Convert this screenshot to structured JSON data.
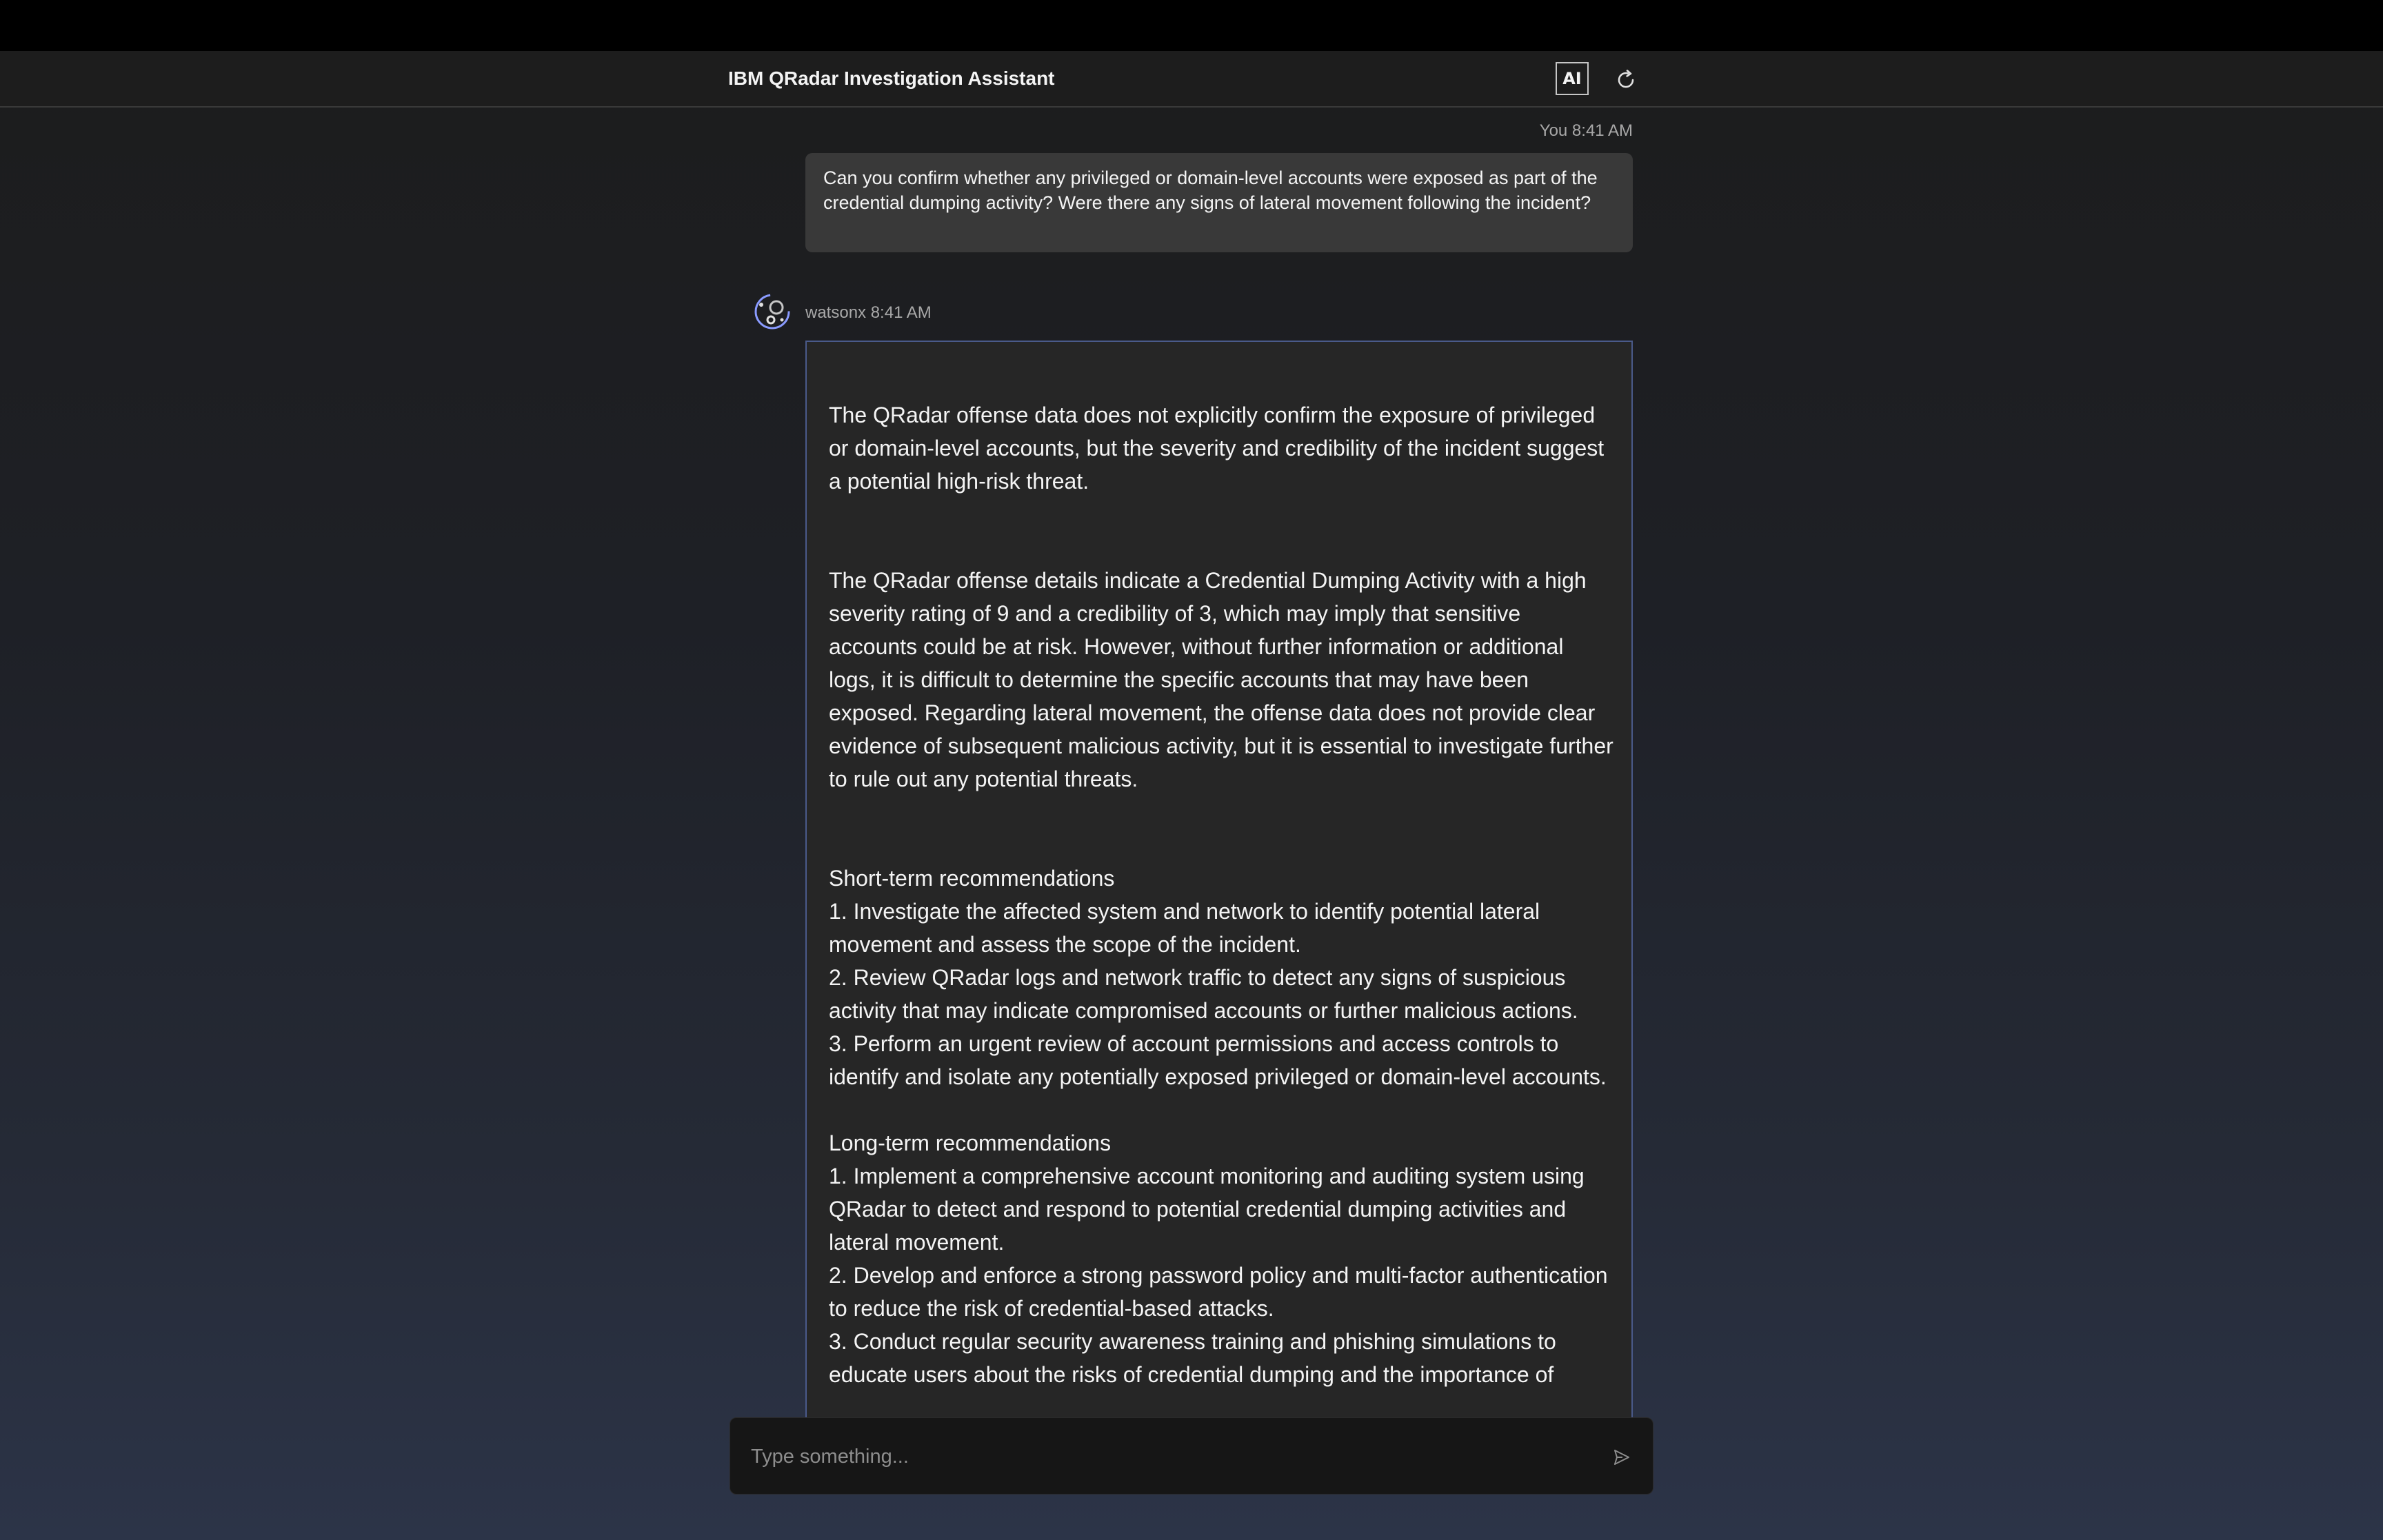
{
  "header": {
    "title": "IBM QRadar Investigation Assistant",
    "ai_badge": "AI",
    "refresh_icon": "refresh-icon"
  },
  "conversation": {
    "user_message": {
      "meta": "You 8:41 AM",
      "text": "Can you confirm whether any privileged or domain-level accounts were exposed as part of the credential dumping activity? Were there any signs of lateral movement following the incident?"
    },
    "assistant_message": {
      "avatar_icon": "watsonx-icon",
      "meta": "watsonx 8:41 AM",
      "text": "The QRadar offense data does not explicitly confirm the exposure of privileged or domain-level accounts, but the severity and credibility of the incident suggest a potential high-risk threat.\n\n\nThe QRadar offense details indicate a Credential Dumping Activity with a high severity rating of 9 and a credibility of 3, which may imply that sensitive accounts could be at risk. However, without further information or additional logs, it is difficult to determine the specific accounts that may have been exposed. Regarding lateral movement, the offense data does not provide clear evidence of subsequent malicious activity, but it is essential to investigate further to rule out any potential threats.\n\n\nShort-term recommendations\n1. Investigate the affected system and network to identify potential lateral movement and assess the scope of the incident.\n2. Review QRadar logs and network traffic to detect any signs of suspicious activity that may indicate compromised accounts or further malicious actions.\n3. Perform an urgent review of account permissions and access controls to identify and isolate any potentially exposed privileged or domain-level accounts.\n\nLong-term recommendations\n1. Implement a comprehensive account monitoring and auditing system using QRadar to detect and respond to potential credential dumping activities and lateral movement.\n2. Develop and enforce a strong password policy and multi-factor authentication to reduce the risk of credential-based attacks.\n3. Conduct regular security awareness training and phishing simulations to educate users about the risks of credential dumping and the importance of"
    }
  },
  "composer": {
    "placeholder": "Type something...",
    "value": "",
    "send_icon": "send-icon"
  },
  "colors": {
    "accent_border": "#4a5a8a",
    "avatar_accent": "#8a9bff"
  }
}
